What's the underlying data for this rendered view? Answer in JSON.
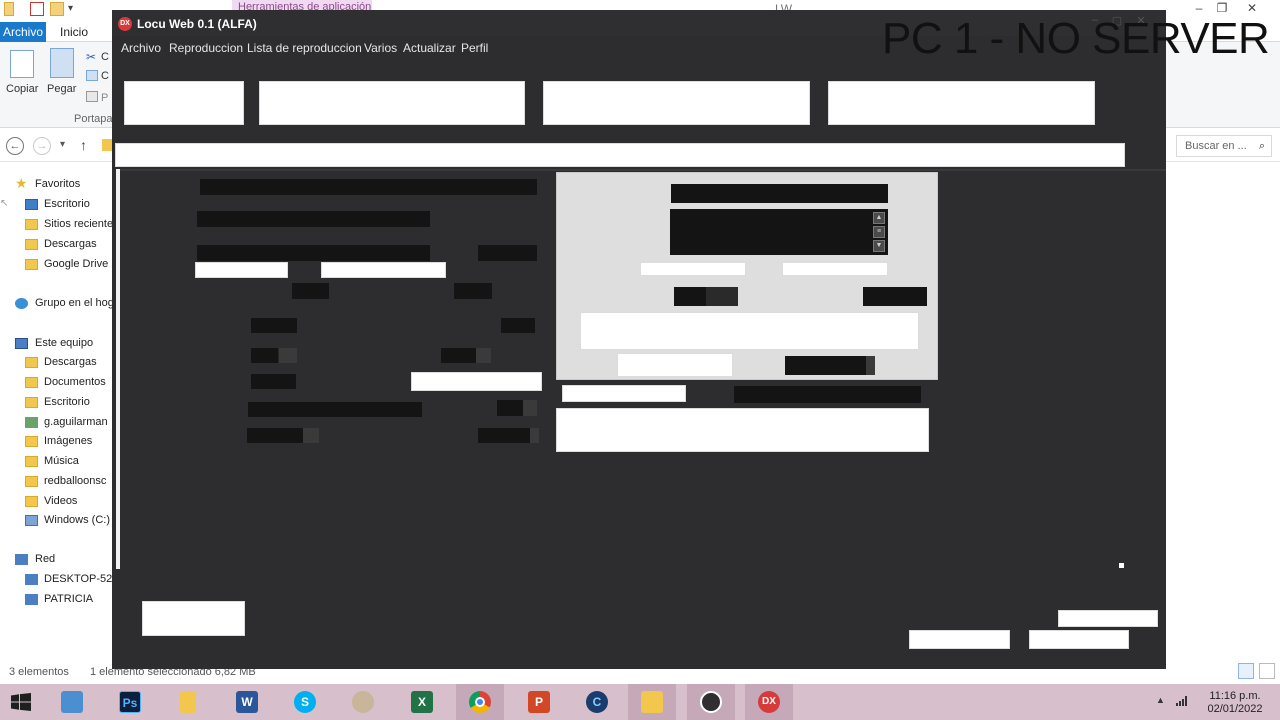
{
  "explorer": {
    "tools_tab": "Herramientas de aplicación",
    "title": "LW",
    "tabs": [
      "Archivo",
      "Inicio"
    ],
    "ribbon": {
      "copy_label": "Copiar",
      "paste_label": "Pegar",
      "group_label": "Portapa",
      "cut_partial": "C",
      "copypath_partial": "C",
      "pasteshortcut_partial": "P"
    },
    "search_placeholder": "Buscar en ...",
    "nav": {
      "favorites": "Favoritos",
      "fav_items": [
        "Escritorio",
        "Sitios reciente",
        "Descargas",
        "Google Drive"
      ],
      "homegroup": "Grupo en el hog",
      "this_pc": "Este equipo",
      "pc_items": [
        "Descargas",
        "Documentos",
        "Escritorio",
        "g.aguilarman",
        "Imágenes",
        "Música",
        "redballoonsc",
        "Videos",
        "Windows (C:)"
      ],
      "network": "Red",
      "network_items": [
        "DESKTOP-52L",
        "PATRICIA"
      ]
    },
    "status": {
      "count": "3 elementos",
      "selection": "1 elemento seleccionado  6,82 MB"
    }
  },
  "app": {
    "logo_text": "DX",
    "title": "Locu Web 0.1 (ALFA)",
    "menu": [
      "Archivo",
      "Reproduccion",
      "Lista de reproduccion",
      "Varios",
      "Actualizar",
      "Perfil"
    ],
    "watermark": "PC 1 - NO SERVER"
  },
  "taskbar": {
    "apps": [
      "start",
      "explorer-computer",
      "photoshop",
      "file-explorer",
      "word",
      "skype",
      "paint",
      "excel",
      "chrome",
      "powerpoint",
      "ccleaner",
      "folder",
      "obs",
      "locu-web"
    ],
    "ps_label": "Ps",
    "word_label": "W",
    "skype_label": "S",
    "excel_label": "X",
    "ppt_label": "P",
    "cc_label": "C",
    "dx_label": "DX",
    "time": "11:16 p.m.",
    "date": "02/01/2022"
  },
  "colors": {
    "accent": "#1979ca",
    "app_bg": "#2d2d2f",
    "taskbar": "#d7bfcb"
  }
}
